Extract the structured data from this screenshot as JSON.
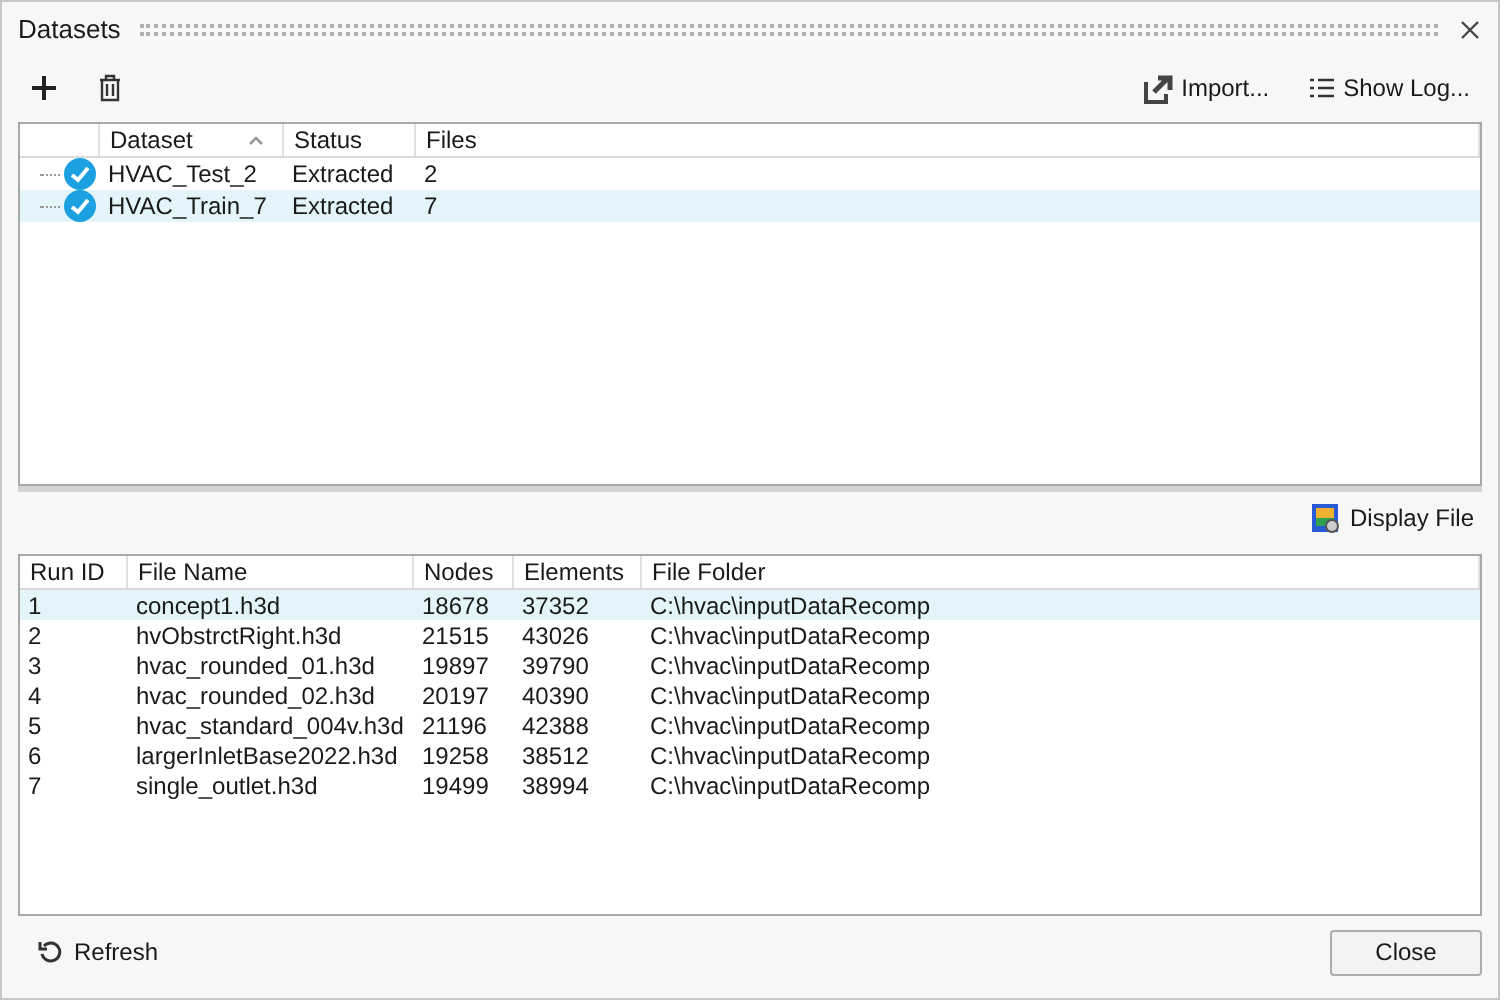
{
  "window": {
    "title": "Datasets"
  },
  "toolbar": {
    "import": "Import...",
    "show_log": "Show Log..."
  },
  "datasets": {
    "columns": [
      {
        "label": "Dataset",
        "sorted": true
      },
      {
        "label": "Status",
        "sorted": false
      },
      {
        "label": "Files",
        "sorted": false
      }
    ],
    "rows": [
      {
        "name": "HVAC_Test_2",
        "status": "Extracted",
        "files": "2",
        "checked": true,
        "selected": false
      },
      {
        "name": "HVAC_Train_7",
        "status": "Extracted",
        "files": "7",
        "checked": true,
        "selected": true
      }
    ]
  },
  "display_file": "Display File",
  "files": {
    "columns": [
      "Run ID",
      "File Name",
      "Nodes",
      "Elements",
      "File Folder"
    ],
    "rows": [
      {
        "cells": [
          "1",
          "concept1.h3d",
          "18678",
          "37352",
          "C:\\hvac\\inputDataRecomp"
        ],
        "selected": true
      },
      {
        "cells": [
          "2",
          "hvObstrctRight.h3d",
          "21515",
          "43026",
          "C:\\hvac\\inputDataRecomp"
        ],
        "selected": false
      },
      {
        "cells": [
          "3",
          "hvac_rounded_01.h3d",
          "19897",
          "39790",
          "C:\\hvac\\inputDataRecomp"
        ],
        "selected": false
      },
      {
        "cells": [
          "4",
          "hvac_rounded_02.h3d",
          "20197",
          "40390",
          "C:\\hvac\\inputDataRecomp"
        ],
        "selected": false
      },
      {
        "cells": [
          "5",
          "hvac_standard_004v.h3d",
          "21196",
          "42388",
          "C:\\hvac\\inputDataRecomp"
        ],
        "selected": false
      },
      {
        "cells": [
          "6",
          "largerInletBase2022.h3d",
          "19258",
          "38512",
          "C:\\hvac\\inputDataRecomp"
        ],
        "selected": false
      },
      {
        "cells": [
          "7",
          "single_outlet.h3d",
          "19499",
          "38994",
          "C:\\hvac\\inputDataRecomp"
        ],
        "selected": false
      }
    ]
  },
  "footer": {
    "refresh": "Refresh",
    "close": "Close"
  }
}
